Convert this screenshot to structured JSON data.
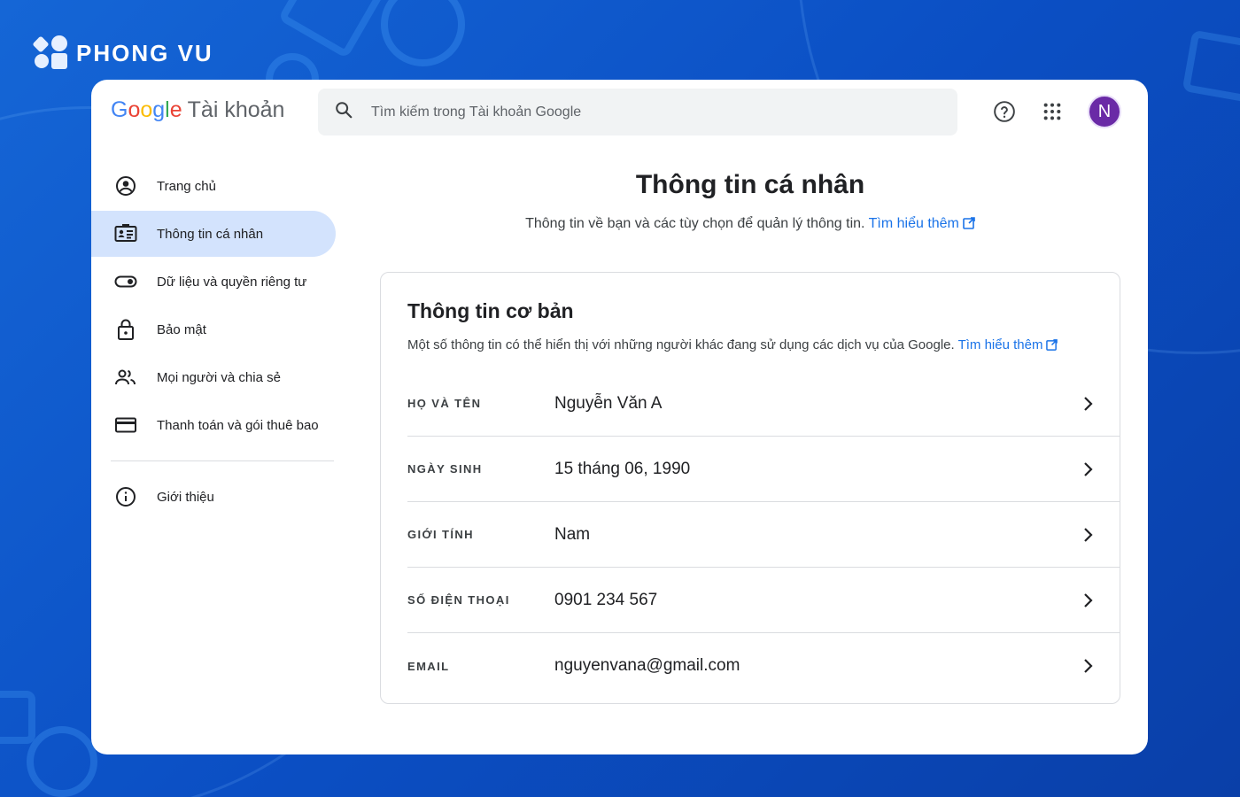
{
  "brand": {
    "name": "PHONG VU"
  },
  "header": {
    "google_word": [
      "G",
      "o",
      "o",
      "g",
      "l",
      "e"
    ],
    "google_colors": [
      "#4285f4",
      "#ea4335",
      "#fbbc05",
      "#4285f4",
      "#34a853",
      "#ea4335"
    ],
    "account_label": "Tài khoản",
    "search_placeholder": "Tìm kiếm trong Tài khoản Google",
    "help_icon": "help-circle-icon",
    "apps_icon": "apps-grid-icon",
    "avatar_initial": "N",
    "avatar_color": "#6a2aa6"
  },
  "sidebar": {
    "items": [
      {
        "label": "Trang chủ",
        "icon": "account-circle-icon",
        "active": false
      },
      {
        "label": "Thông tin cá nhân",
        "icon": "id-card-icon",
        "active": true
      },
      {
        "label": "Dữ liệu và quyền riêng tư",
        "icon": "toggle-icon",
        "active": false
      },
      {
        "label": "Bảo mật",
        "icon": "lock-icon",
        "active": false
      },
      {
        "label": "Mọi người và chia sẻ",
        "icon": "people-icon",
        "active": false
      },
      {
        "label": "Thanh toán và gói thuê bao",
        "icon": "credit-card-icon",
        "active": false
      }
    ],
    "about": {
      "label": "Giới thiệu",
      "icon": "info-icon"
    }
  },
  "main": {
    "title": "Thông tin cá nhân",
    "subtitle": "Thông tin về bạn và các tùy chọn để quản lý thông tin.",
    "learn_more": "Tìm hiểu thêm",
    "card": {
      "title": "Thông tin cơ bản",
      "subtitle": "Một số thông tin có thể hiển thị với những người khác đang sử dụng các dịch vụ của Google.",
      "learn_more": "Tìm hiểu thêm",
      "rows": [
        {
          "label": "HỌ VÀ TÊN",
          "value": "Nguyễn Văn A"
        },
        {
          "label": "NGÀY SINH",
          "value": "15 tháng 06, 1990"
        },
        {
          "label": "GIỚI TÍNH",
          "value": "Nam"
        },
        {
          "label": "SỐ ĐIỆN THOẠI",
          "value": "0901 234 567"
        },
        {
          "label": "EMAIL",
          "value": "nguyenvana@gmail.com"
        }
      ]
    }
  },
  "colors": {
    "accent": "#1a73e8",
    "active_nav": "#d3e3fd"
  }
}
